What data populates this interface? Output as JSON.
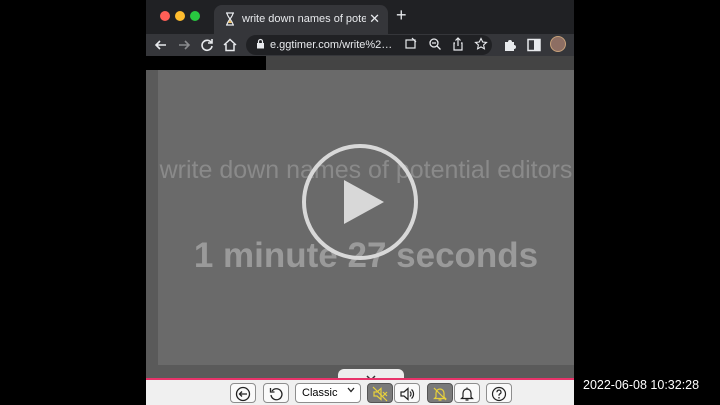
{
  "browser": {
    "tab_title": "write down names of potential",
    "tab_close": "✕",
    "new_tab": "+",
    "url": "e.ggtimer.com/write%2…"
  },
  "timer": {
    "task": "write down names of potential editors",
    "remaining": "1 minute 27 seconds"
  },
  "controls": {
    "mode_selected": "Classic"
  },
  "overlay": {
    "timestamp": "2022-06-08 10:32:28"
  },
  "colors": {
    "accent_bottom_border": "#e8336a",
    "active_toggle_icon": "#e8d13b"
  }
}
